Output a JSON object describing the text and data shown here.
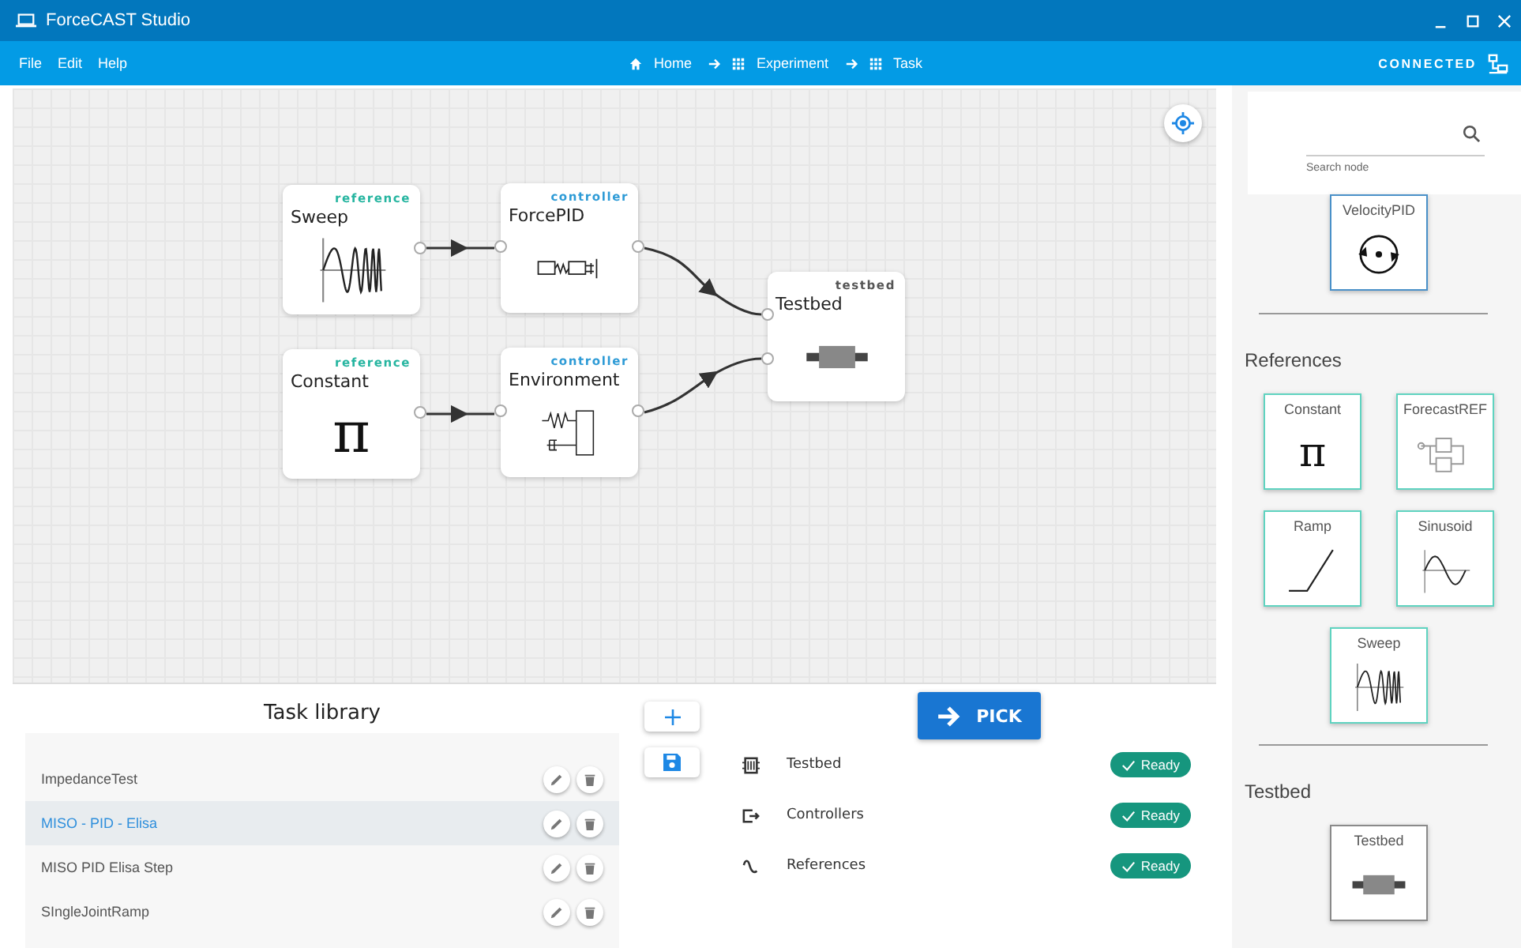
{
  "window": {
    "title": "ForceCAST Studio"
  },
  "menu": [
    "File",
    "Edit",
    "Help"
  ],
  "breadcrumb": [
    {
      "label": "Home",
      "kind": "home"
    },
    {
      "label": "Experiment",
      "kind": "grid"
    },
    {
      "label": "Task",
      "kind": "grid"
    }
  ],
  "connection": {
    "label": "CONNECTED"
  },
  "canvas": {
    "nodes": [
      {
        "title": "Sweep",
        "category": "reference",
        "color": "#26b5a0",
        "kind": "sweep"
      },
      {
        "title": "ForcePID",
        "category": "controller",
        "color": "#2e9bd6",
        "kind": "mass-spring"
      },
      {
        "title": "Constant",
        "category": "reference",
        "color": "#26b5a0",
        "kind": "symbol",
        "symbol": "π"
      },
      {
        "title": "Environment",
        "category": "controller",
        "color": "#2e9bd6",
        "kind": "environment"
      },
      {
        "title": "Testbed",
        "category": "testbed",
        "color": "#555555",
        "kind": "testbed"
      }
    ]
  },
  "palette": {
    "search": {
      "helper_text": "Search node"
    },
    "sections": [
      {
        "cards": [
          {
            "title": "VelocityPID",
            "kind": "rotation",
            "color": "#4a90c8"
          }
        ]
      },
      {
        "heading": "References",
        "cards": [
          {
            "title": "Constant",
            "kind": "symbol",
            "symbol": "π",
            "color": "#5fd3c0"
          },
          {
            "title": "ForecastREF",
            "kind": "forecast",
            "color": "#5fd3c0"
          },
          {
            "title": "Ramp",
            "kind": "ramp",
            "color": "#5fd3c0"
          },
          {
            "title": "Sinusoid",
            "kind": "sine",
            "color": "#5fd3c0"
          },
          {
            "title": "Sweep",
            "kind": "sweep",
            "color": "#5fd3c0"
          }
        ]
      },
      {
        "heading": "Testbed",
        "cards": [
          {
            "title": "Testbed",
            "kind": "testbed",
            "color": "#8a8a8a"
          }
        ]
      }
    ]
  },
  "task_library": {
    "title": "Task library",
    "rows": [
      {
        "name": "ImpedanceTest",
        "selected": false
      },
      {
        "name": "MISO - PID - Elisa",
        "selected": true
      },
      {
        "name": "MISO PID Elisa Step",
        "selected": false
      },
      {
        "name": "SIngleJointRamp",
        "selected": false
      }
    ]
  },
  "pick_button": {
    "label": "PICK"
  },
  "status": [
    {
      "label": "Testbed",
      "kind": "chip",
      "status": "Ready"
    },
    {
      "label": "Controllers",
      "kind": "exit",
      "status": "Ready"
    },
    {
      "label": "References",
      "kind": "wave",
      "status": "Ready"
    }
  ]
}
